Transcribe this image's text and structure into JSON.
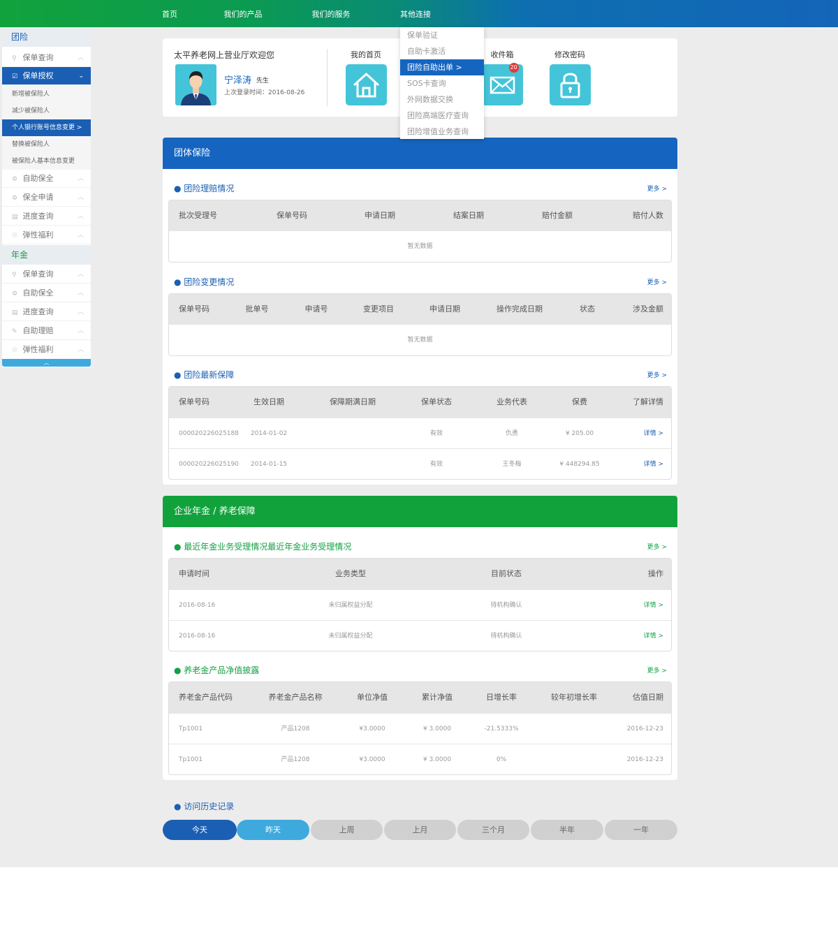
{
  "nav": {
    "items": [
      "首页",
      "我们的产品",
      "我们的服务",
      "其他连接"
    ]
  },
  "dropdown": {
    "items": [
      "保单验证",
      "自助卡激活",
      "团险自助出单 >",
      "SOS卡查询",
      "外网数据交换",
      "团险高端医疗查询",
      "团险增值业务查询"
    ],
    "active_index": 2
  },
  "sidebar": {
    "group1": "团险",
    "group1_items": [
      {
        "label": "保单查询",
        "icon": "search-icon"
      },
      {
        "label": "保单授权",
        "icon": "checkbox-icon",
        "active": true
      }
    ],
    "subitems": [
      "新增被保险人",
      "减少被保险人",
      "个人银行账号信息变更 >",
      "替换被保险人",
      "被保险人基本信息变更"
    ],
    "group1_items2": [
      {
        "label": "自助保全",
        "icon": "gear-icon"
      },
      {
        "label": "保全申请",
        "icon": "gear-icon"
      },
      {
        "label": "进度查询",
        "icon": "list-icon"
      },
      {
        "label": "弹性福利",
        "icon": "gift-icon"
      }
    ],
    "group2": "年金",
    "group2_items": [
      {
        "label": "保单查询",
        "icon": "search-icon"
      },
      {
        "label": "自助保全",
        "icon": "gear-icon"
      },
      {
        "label": "进度查询",
        "icon": "list-icon"
      },
      {
        "label": "自助理赔",
        "icon": "claim-icon"
      },
      {
        "label": "弹性福利",
        "icon": "gift-icon"
      }
    ],
    "collapse": "︿"
  },
  "user": {
    "welcome": "太平养老网上营业厅欢迎您",
    "name": "宁泽涛",
    "title": "先生",
    "last_login": "上次登录时间：2016-08-26"
  },
  "quick": {
    "home": "我的首页",
    "inbox": "收件箱",
    "inbox_count": "20",
    "password": "修改密码"
  },
  "group_panel": {
    "title": "团体保险",
    "claims": {
      "title": "团险理赔情况",
      "more": "更多 >",
      "headers": [
        "批次受理号",
        "保单号码",
        "申请日期",
        "结案日期",
        "赔付金额",
        "赔付人数"
      ],
      "empty": "暂无数据"
    },
    "changes": {
      "title": "团险变更情况",
      "more": "更多 >",
      "headers": [
        "保单号码",
        "批单号",
        "申请号",
        "变更项目",
        "申请日期",
        "操作完成日期",
        "状态",
        "涉及金额"
      ],
      "empty": "暂无数据"
    },
    "latest": {
      "title": "团险最新保障",
      "more": "更多 >",
      "headers": [
        "保单号码",
        "生效日期",
        "保障期满日期",
        "保单状态",
        "业务代表",
        "保费",
        "了解详情"
      ],
      "rows": [
        [
          "000020226025188",
          "2014-01-02",
          "",
          "有效",
          "仇勇",
          "¥ 205.00",
          "详情 >"
        ],
        [
          "000020226025190",
          "2014-01-15",
          "",
          "有效",
          "王冬梅",
          "¥ 448294.85",
          "详情 >"
        ]
      ]
    }
  },
  "pension_panel": {
    "title": "企业年金 / 养老保障",
    "recent": {
      "title": "最近年金业务受理情况最近年金业务受理情况",
      "more": "更多 >",
      "headers": [
        "申请时间",
        "业务类型",
        "目前状态",
        "操作"
      ],
      "rows": [
        [
          "2016-08-16",
          "未归属权益分配",
          "待机构确认",
          "详情 >"
        ],
        [
          "2016-08-16",
          "未归属权益分配",
          "待机构确认",
          "详情 >"
        ]
      ]
    },
    "nav": {
      "title": "养老金产品净值披露",
      "more": "更多 >",
      "headers": [
        "养老金产品代码",
        "养老金产品名称",
        "单位净值",
        "累计净值",
        "日增长率",
        "较年初增长率",
        "估值日期"
      ],
      "rows": [
        [
          "Tp1001",
          "产品1208",
          "¥3.0000",
          "¥ 3.0000",
          "-21.5333%",
          "",
          "2016-12-23"
        ],
        [
          "Tp1001",
          "产品1208",
          "¥3.0000",
          "¥ 3.0000",
          "0%",
          "",
          "2016-12-23"
        ]
      ]
    }
  },
  "history": {
    "title": "访问历史记录",
    "buttons": [
      "今天",
      "昨天",
      "上周",
      "上月",
      "三个月",
      "半年",
      "一年"
    ]
  }
}
